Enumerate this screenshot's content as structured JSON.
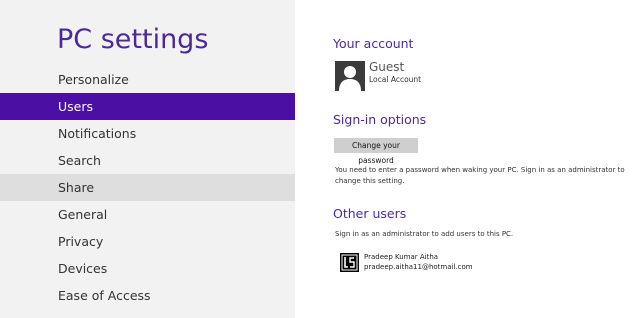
{
  "nav": {
    "title": "PC settings",
    "items": [
      {
        "label": "Personalize"
      },
      {
        "label": "Users"
      },
      {
        "label": "Notifications"
      },
      {
        "label": "Search"
      },
      {
        "label": "Share"
      },
      {
        "label": "General"
      },
      {
        "label": "Privacy"
      },
      {
        "label": "Devices"
      },
      {
        "label": "Ease of Access"
      }
    ],
    "selected": "Users",
    "highlighted": "Share"
  },
  "account": {
    "heading": "Your account",
    "name": "Guest",
    "type": "Local Account"
  },
  "signin": {
    "heading": "Sign-in options",
    "button_label": "Change your password",
    "note": "You need to enter a password when waking your PC. Sign in as an administrator to change this setting."
  },
  "other_users": {
    "heading": "Other users",
    "note": "Sign in as an administrator to add users to this PC.",
    "users": [
      {
        "name": "Pradeep Kumar Aitha",
        "email": "pradeep.aitha11@hotmail.com"
      }
    ]
  },
  "colors": {
    "accent": "#4b2a98",
    "selected_bg": "#4b0fa3",
    "nav_bg": "#f2f2f2",
    "hover_bg": "#dedede",
    "button_bg": "#cfcfcf"
  },
  "icons": {
    "account_avatar": "user-silhouette-icon",
    "other_user_avatar": "user-photo-icon"
  }
}
